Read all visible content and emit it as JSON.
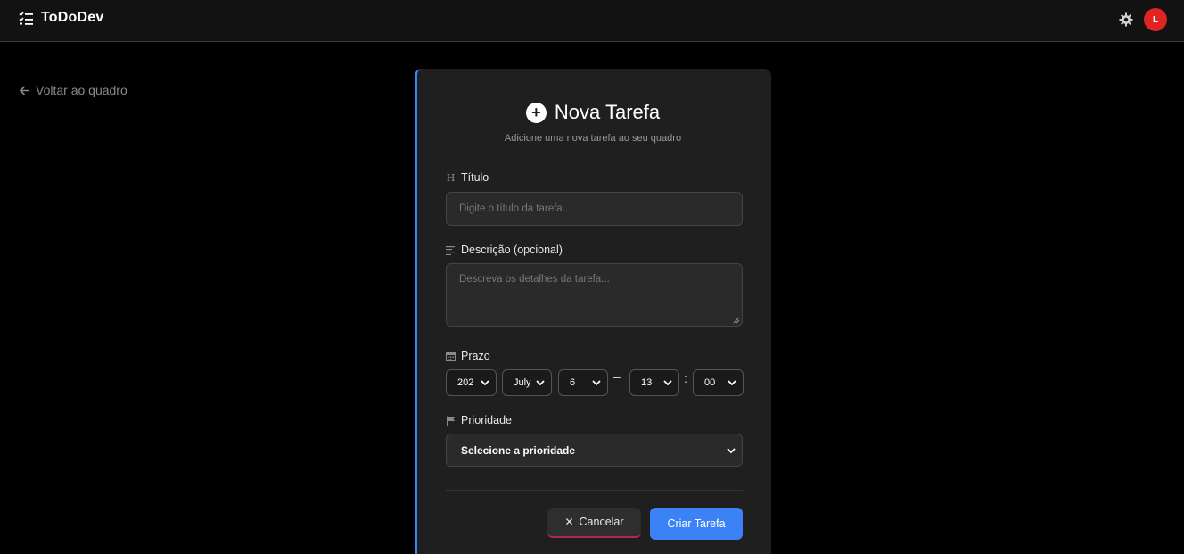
{
  "header": {
    "brand": "ToDoDev",
    "avatar_initial": "L"
  },
  "nav": {
    "back_label": "Voltar ao quadro"
  },
  "form": {
    "title": "Nova Tarefa",
    "subtitle": "Adicione uma nova tarefa ao seu quadro",
    "title_field": {
      "label": "Título",
      "placeholder": "Digite o título da tarefa..."
    },
    "description_field": {
      "label": "Descrição (opcional)",
      "placeholder": "Descreva os detalhes da tarefa..."
    },
    "deadline": {
      "label": "Prazo",
      "year": "202",
      "month": "July",
      "day": "6",
      "hour": "13",
      "minute": "00",
      "date_time_separator": "–",
      "time_separator": ":"
    },
    "priority": {
      "label": "Prioridade",
      "selected": "Selecione a prioridade"
    },
    "cancel_label": "Cancelar",
    "submit_label": "Criar Tarefa"
  },
  "colors": {
    "accent": "#3b82f6",
    "avatar": "#e02424",
    "background": "#000000",
    "card": "#1f1f1f"
  }
}
